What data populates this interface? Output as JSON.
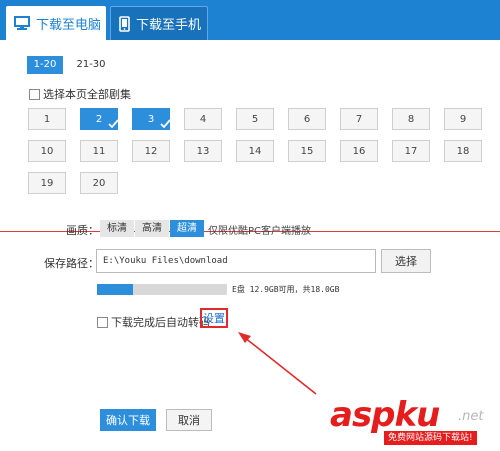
{
  "tabs": [
    {
      "label": "下载至电脑",
      "icon": "monitor-icon",
      "active": true
    },
    {
      "label": "下载至手机",
      "icon": "phone-icon",
      "active": false
    }
  ],
  "ranges": [
    {
      "label": "1-20",
      "active": true
    },
    {
      "label": "21-30",
      "active": false
    }
  ],
  "select_all": {
    "label": "选择本页全部剧集",
    "checked": false
  },
  "episodes": [
    {
      "num": "1",
      "selected": false
    },
    {
      "num": "2",
      "selected": true
    },
    {
      "num": "3",
      "selected": true
    },
    {
      "num": "4",
      "selected": false
    },
    {
      "num": "5",
      "selected": false
    },
    {
      "num": "6",
      "selected": false
    },
    {
      "num": "7",
      "selected": false
    },
    {
      "num": "8",
      "selected": false
    },
    {
      "num": "9",
      "selected": false
    },
    {
      "num": "10",
      "selected": false
    },
    {
      "num": "11",
      "selected": false
    },
    {
      "num": "12",
      "selected": false
    },
    {
      "num": "13",
      "selected": false
    },
    {
      "num": "14",
      "selected": false
    },
    {
      "num": "15",
      "selected": false
    },
    {
      "num": "16",
      "selected": false
    },
    {
      "num": "17",
      "selected": false
    },
    {
      "num": "18",
      "selected": false
    },
    {
      "num": "19",
      "selected": false
    },
    {
      "num": "20",
      "selected": false
    }
  ],
  "quality": {
    "label": "画质：",
    "options": [
      "标清",
      "高清",
      "超清"
    ],
    "selected": "超清",
    "note": "仅限优酷PC客户端播放"
  },
  "save_path": {
    "label": "保存路径：",
    "value": "E:\\Youku Files\\download",
    "choose_label": "选择"
  },
  "disk": {
    "info": "E盘 12.9GB可用，共18.0GB",
    "used_fraction": 0.28
  },
  "auto_convert": {
    "label": "下载完成后自动转码",
    "checked": false,
    "settings_label": "设置"
  },
  "buttons": {
    "confirm": "确认下载",
    "cancel": "取消"
  },
  "watermark": {
    "logo": "aspku",
    "suffix": ".net",
    "tagline": "免费网站源码下载站!"
  },
  "colors": {
    "accent": "#2d8fdc",
    "tabbar": "#1e82d2",
    "highlight": "#e12b2b"
  }
}
